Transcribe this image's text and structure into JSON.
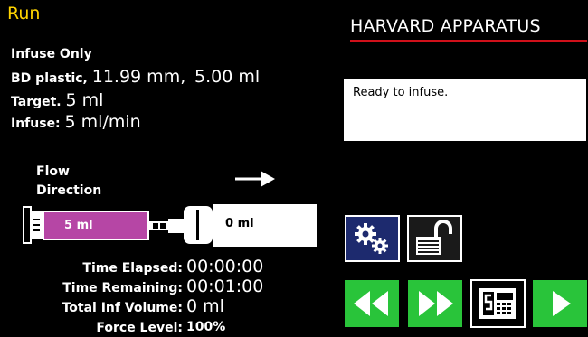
{
  "screen": {
    "title": "Run"
  },
  "brand": {
    "name": "HARVARD APPARATUS"
  },
  "config": {
    "mode": "Infuse Only",
    "syringe_type": "BD plastic,",
    "syringe_diameter": "11.99 mm,",
    "syringe_volume": "5.00 ml",
    "target_label": "Target.",
    "target_value": "5 ml",
    "rate_label": "Infuse:",
    "rate_value": "5 ml/min"
  },
  "status": {
    "message": "Ready to infuse."
  },
  "flow": {
    "label_line1": "Flow",
    "label_line2": "Direction",
    "direction_icon": "right-arrow-icon"
  },
  "syringe": {
    "barrel_volume": "5 ml",
    "delivered_volume": "0 ml",
    "barrel_color": "#b646a5"
  },
  "stats": {
    "time_elapsed_label": "Time Elapsed:",
    "time_elapsed": "00:00:00",
    "time_remaining_label": "Time Remaining:",
    "time_remaining": "00:01:00",
    "total_volume_label": "Total Inf Volume:",
    "total_volume": "0 ml",
    "force_label": "Force Level:",
    "force": "100%"
  },
  "buttons": {
    "settings_icon": "gears-icon",
    "lock_icon": "unlocked-padlock-icon",
    "rewind_icon": "rewind-icon",
    "ffwd_icon": "fast-forward-icon",
    "method_icon": "method-screen-icon",
    "run_icon": "play-icon"
  },
  "colors": {
    "title": "#ffd400",
    "brand_rule": "#d0101a",
    "action_green": "#29c43a",
    "settings_blue": "#1d2a6e"
  }
}
